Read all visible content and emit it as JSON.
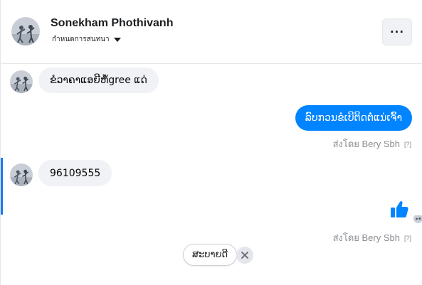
{
  "header": {
    "name": "Sonekham Phothivanh",
    "subtitle": "กำหนดการสนทนา",
    "more_label": "···",
    "more_icon": "more-dots-icon",
    "caret_icon": "caret-down-icon"
  },
  "messages": [
    {
      "direction": "incoming",
      "text": "ຂໍວາຄາແອຍີຫໍ້gree ແດ່"
    },
    {
      "direction": "outgoing",
      "text": "ລົບກວນຂໍເບີຕິດຕໍ່ແນ່ເຈົ້າ"
    },
    {
      "direction": "incoming",
      "text": "96109555"
    },
    {
      "direction": "outgoing",
      "icon": "thumbs-up-icon"
    }
  ],
  "seen_labels": [
    {
      "text": "ส่งโดย Bery Sbh",
      "mark": "[?]"
    },
    {
      "text": "ส่งโดย Bery Sbh",
      "mark": "[?]"
    }
  ],
  "quick_reply": {
    "label": "ສະບາຍດີ",
    "close_icon": "close-icon"
  },
  "colors": {
    "accent": "#1877f2",
    "outgoing_bubble": "#0084ff",
    "incoming_bubble": "#f0f2f5",
    "seen_text": "#8a8d91"
  }
}
